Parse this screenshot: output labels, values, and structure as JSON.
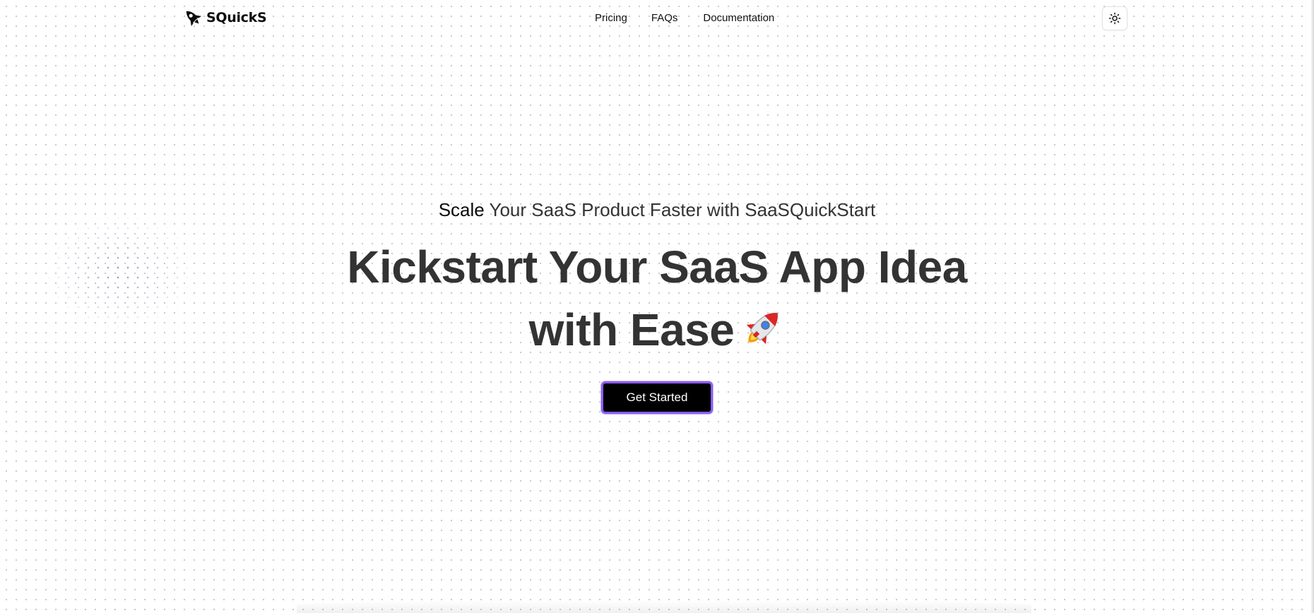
{
  "brand": {
    "name": "SQuickS",
    "logo_icon": "rocket-icon"
  },
  "nav": {
    "links": [
      {
        "label": "Pricing"
      },
      {
        "label": "FAQs"
      },
      {
        "label": "Documentation"
      }
    ],
    "theme_toggle_icon": "sun-icon"
  },
  "hero": {
    "subtitle_rotating_word": "Scale",
    "subtitle_rest": " Your SaaS Product Faster with SaaSQuickStart",
    "headline_line1": "Kickstart Your SaaS App Idea",
    "headline_line2": "with Ease",
    "headline_emoji": "rocket-emoji",
    "cta_label": "Get Started"
  },
  "colors": {
    "text": "#333333",
    "cta_background": "#000000",
    "cta_border": "#8b5cf6",
    "background_dots": "#c9cbd0"
  }
}
